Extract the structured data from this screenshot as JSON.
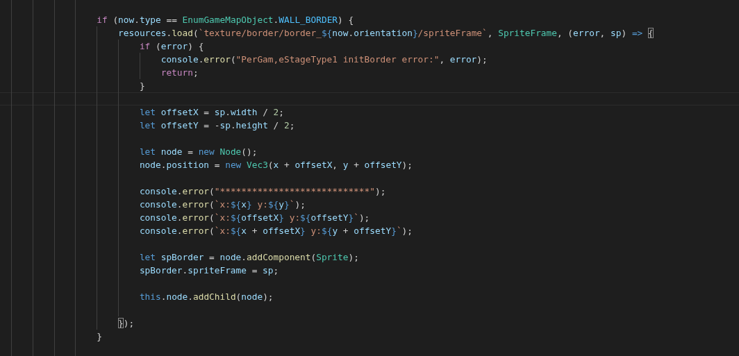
{
  "editor": {
    "lines": [
      {
        "kind": "blank"
      },
      {
        "tokens": [
          {
            "text": "                if",
            "kind": "control"
          },
          {
            "text": " (",
            "kind": "punct"
          },
          {
            "text": "now",
            "kind": "var"
          },
          {
            "text": ".",
            "kind": "punct"
          },
          {
            "text": "type",
            "kind": "var"
          },
          {
            "text": " == ",
            "kind": "punct"
          },
          {
            "text": "EnumGameMapObject",
            "kind": "type"
          },
          {
            "text": ".",
            "kind": "punct"
          },
          {
            "text": "WALL_BORDER",
            "kind": "const"
          },
          {
            "text": ") {",
            "kind": "punct"
          }
        ]
      },
      {
        "tokens": [
          {
            "text": "                    resources",
            "kind": "var"
          },
          {
            "text": ".",
            "kind": "punct"
          },
          {
            "text": "load",
            "kind": "func"
          },
          {
            "text": "(",
            "kind": "punct"
          },
          {
            "text": "`texture/border/border_",
            "kind": "string"
          },
          {
            "text": "${",
            "kind": "interp"
          },
          {
            "text": "now",
            "kind": "var"
          },
          {
            "text": ".",
            "kind": "punct"
          },
          {
            "text": "orientation",
            "kind": "var"
          },
          {
            "text": "}",
            "kind": "interp"
          },
          {
            "text": "/spriteFrame`",
            "kind": "string"
          },
          {
            "text": ", ",
            "kind": "punct"
          },
          {
            "text": "SpriteFrame",
            "kind": "type"
          },
          {
            "text": ", (",
            "kind": "punct"
          },
          {
            "text": "error",
            "kind": "var"
          },
          {
            "text": ", ",
            "kind": "punct"
          },
          {
            "text": "sp",
            "kind": "var"
          },
          {
            "text": ") ",
            "kind": "punct"
          },
          {
            "text": "=> ",
            "kind": "storage"
          },
          {
            "text": "{",
            "kind": "match"
          }
        ]
      },
      {
        "tokens": [
          {
            "text": "                        if",
            "kind": "control"
          },
          {
            "text": " (",
            "kind": "punct"
          },
          {
            "text": "error",
            "kind": "var"
          },
          {
            "text": ") {",
            "kind": "punct"
          }
        ]
      },
      {
        "tokens": [
          {
            "text": "                            console",
            "kind": "var"
          },
          {
            "text": ".",
            "kind": "punct"
          },
          {
            "text": "error",
            "kind": "func"
          },
          {
            "text": "(",
            "kind": "punct"
          },
          {
            "text": "\"PerGam,eStageType1 initBorder error:\"",
            "kind": "string"
          },
          {
            "text": ", ",
            "kind": "punct"
          },
          {
            "text": "error",
            "kind": "var"
          },
          {
            "text": ");",
            "kind": "punct"
          }
        ]
      },
      {
        "tokens": [
          {
            "text": "                            return",
            "kind": "control"
          },
          {
            "text": ";",
            "kind": "punct"
          }
        ]
      },
      {
        "tokens": [
          {
            "text": "                        }",
            "kind": "punct"
          }
        ]
      },
      {
        "kind": "blank",
        "current": true
      },
      {
        "tokens": [
          {
            "text": "                        let",
            "kind": "storage"
          },
          {
            "text": " offsetX",
            "kind": "var"
          },
          {
            "text": " = ",
            "kind": "punct"
          },
          {
            "text": "sp",
            "kind": "var"
          },
          {
            "text": ".",
            "kind": "punct"
          },
          {
            "text": "width",
            "kind": "var"
          },
          {
            "text": " / ",
            "kind": "punct"
          },
          {
            "text": "2",
            "kind": "number"
          },
          {
            "text": ";",
            "kind": "punct"
          }
        ]
      },
      {
        "tokens": [
          {
            "text": "                        let",
            "kind": "storage"
          },
          {
            "text": " offsetY",
            "kind": "var"
          },
          {
            "text": " = -",
            "kind": "punct"
          },
          {
            "text": "sp",
            "kind": "var"
          },
          {
            "text": ".",
            "kind": "punct"
          },
          {
            "text": "height",
            "kind": "var"
          },
          {
            "text": " / ",
            "kind": "punct"
          },
          {
            "text": "2",
            "kind": "number"
          },
          {
            "text": ";",
            "kind": "punct"
          }
        ]
      },
      {
        "kind": "blank"
      },
      {
        "tokens": [
          {
            "text": "                        let",
            "kind": "storage"
          },
          {
            "text": " node",
            "kind": "var"
          },
          {
            "text": " = ",
            "kind": "punct"
          },
          {
            "text": "new ",
            "kind": "storage"
          },
          {
            "text": "Node",
            "kind": "type"
          },
          {
            "text": "();",
            "kind": "punct"
          }
        ]
      },
      {
        "tokens": [
          {
            "text": "                        node",
            "kind": "var"
          },
          {
            "text": ".",
            "kind": "punct"
          },
          {
            "text": "position",
            "kind": "var"
          },
          {
            "text": " = ",
            "kind": "punct"
          },
          {
            "text": "new ",
            "kind": "storage"
          },
          {
            "text": "Vec3",
            "kind": "type"
          },
          {
            "text": "(",
            "kind": "punct"
          },
          {
            "text": "x",
            "kind": "var"
          },
          {
            "text": " + ",
            "kind": "punct"
          },
          {
            "text": "offsetX",
            "kind": "var"
          },
          {
            "text": ", ",
            "kind": "punct"
          },
          {
            "text": "y",
            "kind": "var"
          },
          {
            "text": " + ",
            "kind": "punct"
          },
          {
            "text": "offsetY",
            "kind": "var"
          },
          {
            "text": ");",
            "kind": "punct"
          }
        ]
      },
      {
        "kind": "blank"
      },
      {
        "tokens": [
          {
            "text": "                        console",
            "kind": "var"
          },
          {
            "text": ".",
            "kind": "punct"
          },
          {
            "text": "error",
            "kind": "func"
          },
          {
            "text": "(",
            "kind": "punct"
          },
          {
            "text": "\"****************************\"",
            "kind": "string"
          },
          {
            "text": ");",
            "kind": "punct"
          }
        ]
      },
      {
        "tokens": [
          {
            "text": "                        console",
            "kind": "var"
          },
          {
            "text": ".",
            "kind": "punct"
          },
          {
            "text": "error",
            "kind": "func"
          },
          {
            "text": "(",
            "kind": "punct"
          },
          {
            "text": "`x:",
            "kind": "string"
          },
          {
            "text": "${",
            "kind": "interp"
          },
          {
            "text": "x",
            "kind": "var"
          },
          {
            "text": "}",
            "kind": "interp"
          },
          {
            "text": " y:",
            "kind": "string"
          },
          {
            "text": "${",
            "kind": "interp"
          },
          {
            "text": "y",
            "kind": "var"
          },
          {
            "text": "}",
            "kind": "interp"
          },
          {
            "text": "`",
            "kind": "string"
          },
          {
            "text": ");",
            "kind": "punct"
          }
        ]
      },
      {
        "tokens": [
          {
            "text": "                        console",
            "kind": "var"
          },
          {
            "text": ".",
            "kind": "punct"
          },
          {
            "text": "error",
            "kind": "func"
          },
          {
            "text": "(",
            "kind": "punct"
          },
          {
            "text": "`x:",
            "kind": "string"
          },
          {
            "text": "${",
            "kind": "interp"
          },
          {
            "text": "offsetX",
            "kind": "var"
          },
          {
            "text": "}",
            "kind": "interp"
          },
          {
            "text": " y:",
            "kind": "string"
          },
          {
            "text": "${",
            "kind": "interp"
          },
          {
            "text": "offsetY",
            "kind": "var"
          },
          {
            "text": "}",
            "kind": "interp"
          },
          {
            "text": "`",
            "kind": "string"
          },
          {
            "text": ");",
            "kind": "punct"
          }
        ]
      },
      {
        "tokens": [
          {
            "text": "                        console",
            "kind": "var"
          },
          {
            "text": ".",
            "kind": "punct"
          },
          {
            "text": "error",
            "kind": "func"
          },
          {
            "text": "(",
            "kind": "punct"
          },
          {
            "text": "`x:",
            "kind": "string"
          },
          {
            "text": "${",
            "kind": "interp"
          },
          {
            "text": "x",
            "kind": "var"
          },
          {
            "text": " + ",
            "kind": "punct"
          },
          {
            "text": "offsetX",
            "kind": "var"
          },
          {
            "text": "}",
            "kind": "interp"
          },
          {
            "text": " y:",
            "kind": "string"
          },
          {
            "text": "${",
            "kind": "interp"
          },
          {
            "text": "y",
            "kind": "var"
          },
          {
            "text": " + ",
            "kind": "punct"
          },
          {
            "text": "offsetY",
            "kind": "var"
          },
          {
            "text": "}",
            "kind": "interp"
          },
          {
            "text": "`",
            "kind": "string"
          },
          {
            "text": ");",
            "kind": "punct"
          }
        ]
      },
      {
        "kind": "blank"
      },
      {
        "tokens": [
          {
            "text": "                        let",
            "kind": "storage"
          },
          {
            "text": " spBorder",
            "kind": "var"
          },
          {
            "text": " = ",
            "kind": "punct"
          },
          {
            "text": "node",
            "kind": "var"
          },
          {
            "text": ".",
            "kind": "punct"
          },
          {
            "text": "addComponent",
            "kind": "func"
          },
          {
            "text": "(",
            "kind": "punct"
          },
          {
            "text": "Sprite",
            "kind": "type"
          },
          {
            "text": ");",
            "kind": "punct"
          }
        ]
      },
      {
        "tokens": [
          {
            "text": "                        spBorder",
            "kind": "var"
          },
          {
            "text": ".",
            "kind": "punct"
          },
          {
            "text": "spriteFrame",
            "kind": "var"
          },
          {
            "text": " = ",
            "kind": "punct"
          },
          {
            "text": "sp",
            "kind": "var"
          },
          {
            "text": ";",
            "kind": "punct"
          }
        ]
      },
      {
        "kind": "blank"
      },
      {
        "tokens": [
          {
            "text": "                        this",
            "kind": "storage"
          },
          {
            "text": ".",
            "kind": "punct"
          },
          {
            "text": "node",
            "kind": "var"
          },
          {
            "text": ".",
            "kind": "punct"
          },
          {
            "text": "addChild",
            "kind": "func"
          },
          {
            "text": "(",
            "kind": "punct"
          },
          {
            "text": "node",
            "kind": "var"
          },
          {
            "text": ");",
            "kind": "punct"
          }
        ]
      },
      {
        "kind": "blank"
      },
      {
        "tokens": [
          {
            "text": "                    }",
            "kind": "match"
          },
          {
            "text": ");",
            "kind": "punct"
          }
        ]
      },
      {
        "tokens": [
          {
            "text": "                }",
            "kind": "punct"
          }
        ]
      },
      {
        "kind": "blank"
      }
    ]
  }
}
